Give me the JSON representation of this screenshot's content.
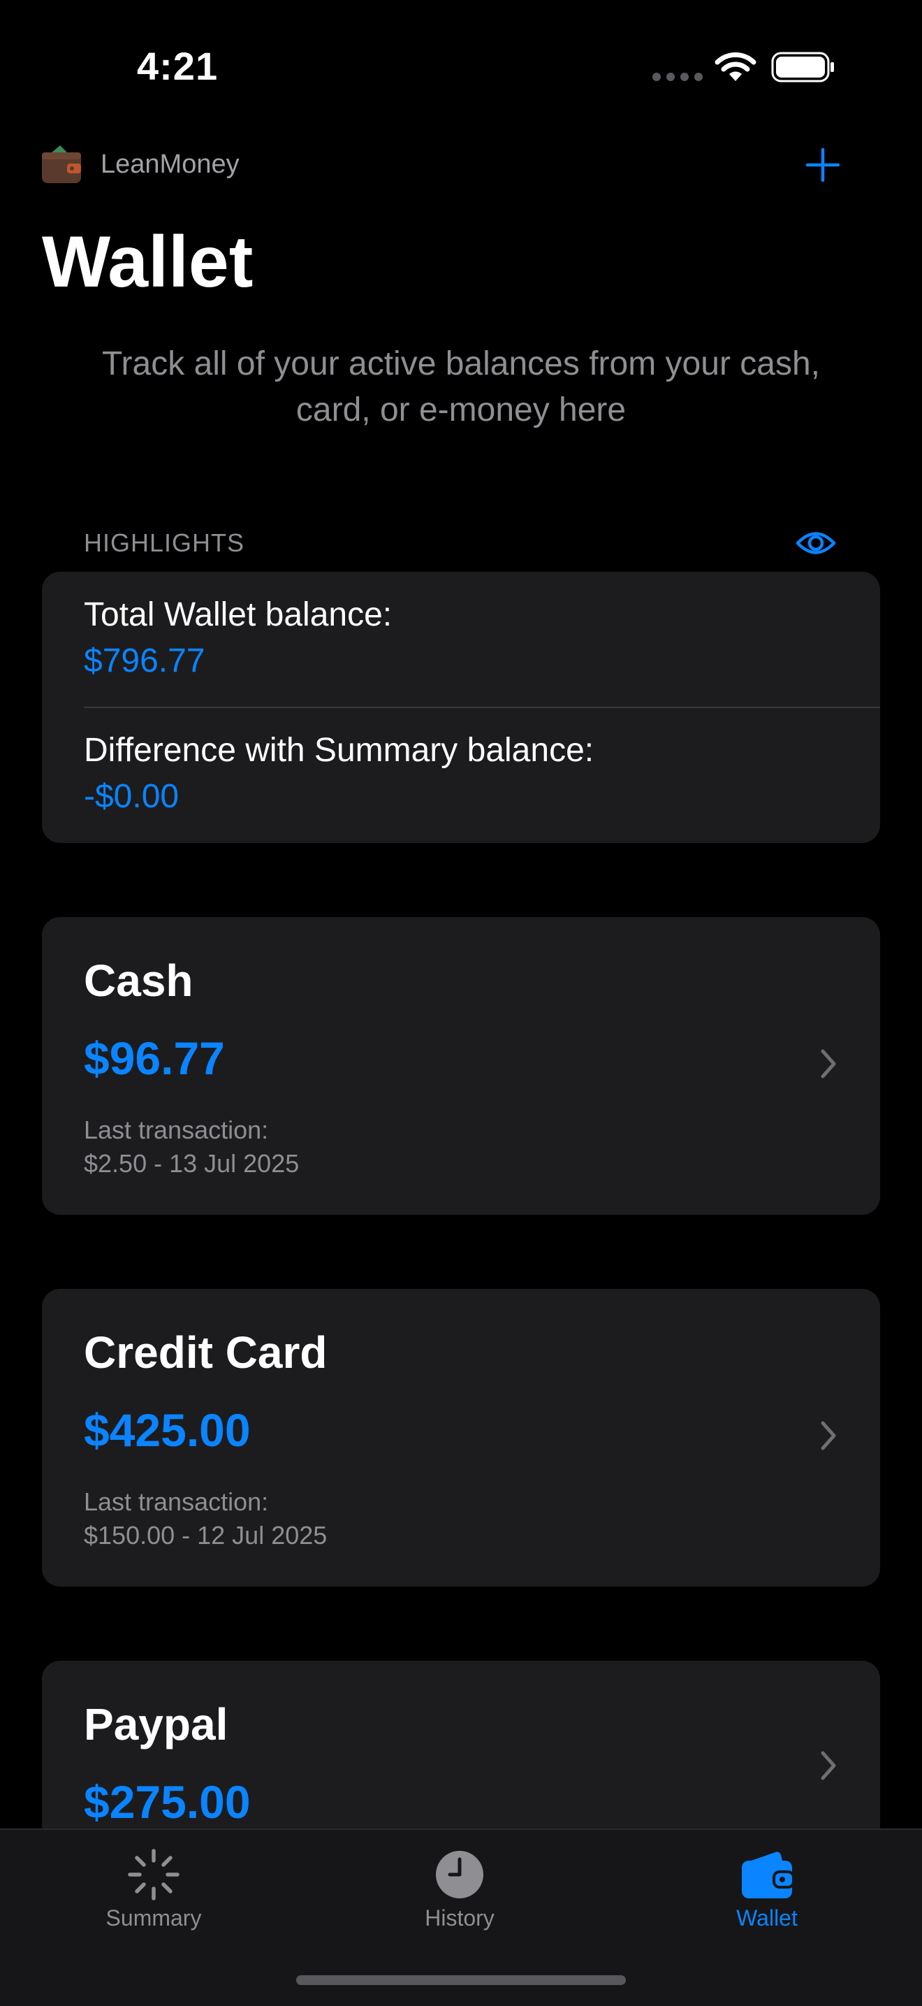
{
  "status_bar": {
    "time": "4:21"
  },
  "header": {
    "app_name": "LeanMoney",
    "title": "Wallet",
    "subtitle": "Track all of your active balances from your cash, card, or e-money here"
  },
  "highlights": {
    "section_label": "HIGHLIGHTS",
    "total_label": "Total Wallet balance:",
    "total_value": "$796.77",
    "difference_label": "Difference with Summary balance:",
    "difference_value": "-$0.00"
  },
  "wallets": [
    {
      "name": "Cash",
      "amount": "$96.77",
      "last_label": "Last transaction:",
      "last_value": "$2.50 - 13 Jul 2025"
    },
    {
      "name": "Credit Card",
      "amount": "$425.00",
      "last_label": "Last transaction:",
      "last_value": "$150.00 - 12 Jul 2025"
    },
    {
      "name": "Paypal",
      "amount": "$275.00"
    }
  ],
  "tabs": [
    {
      "label": "Summary",
      "icon": "spinner-icon",
      "active": false
    },
    {
      "label": "History",
      "icon": "clock-icon",
      "active": false
    },
    {
      "label": "Wallet",
      "icon": "wallet-icon",
      "active": true
    }
  ],
  "colors": {
    "accent": "#0a84ff",
    "card": "#1c1c1e",
    "background": "#000000",
    "secondary_text": "#8e8e93"
  }
}
